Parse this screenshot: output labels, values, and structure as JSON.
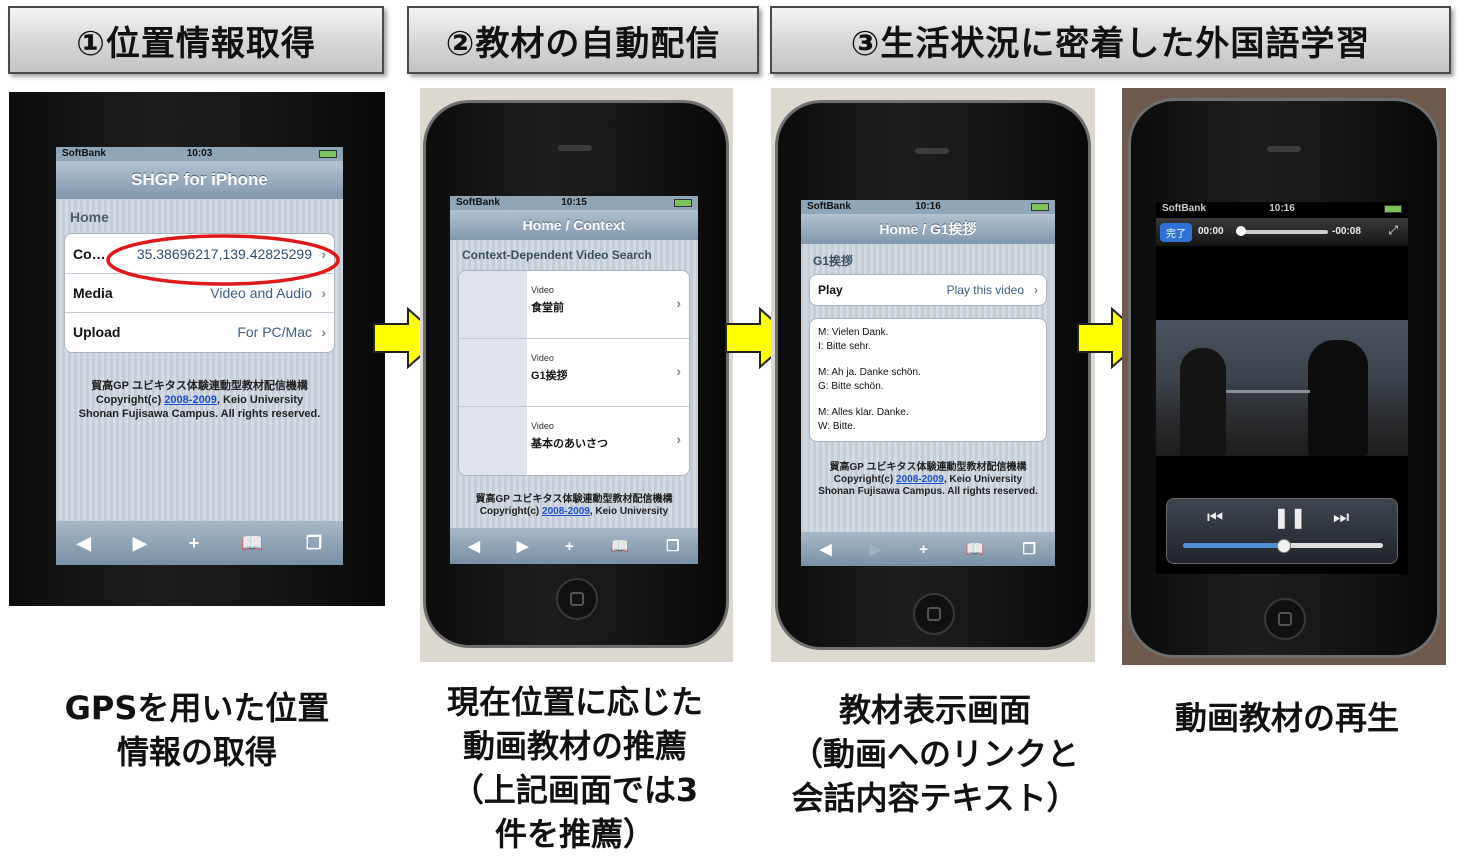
{
  "steps": [
    {
      "label": "①位置情報取得"
    },
    {
      "label": "②教材の自動配信"
    },
    {
      "label": "③生活状況に密着した外国語学習"
    }
  ],
  "captions": {
    "c1": [
      "GPSを用いた位置",
      "情報の取得"
    ],
    "c2": [
      "現在位置に応じた",
      "動画教材の推薦",
      "（上記画面では3",
      "件を推薦）"
    ],
    "c3": [
      "教材表示画面",
      "（動画へのリンクと",
      "会話内容テキスト）"
    ],
    "c4": [
      "動画教材の再生"
    ]
  },
  "phone1": {
    "carrier": "SoftBank",
    "time": "10:03",
    "title": "SHGP for iPhone",
    "section": "Home",
    "rows": [
      {
        "label": "Co…",
        "value": "35.38696217,139.42825299"
      },
      {
        "label": "Media",
        "value": "Video and Audio"
      },
      {
        "label": "Upload",
        "value": "For PC/Mac"
      }
    ],
    "footer_line1": "貿高GP ユビキタス体験連動型教材配信機構",
    "footer_copy": "Copyright(c)",
    "footer_years": "2008-2009",
    "footer_rest": ", Keio University",
    "footer_line3": "Shonan Fujisawa Campus. All rights reserved.",
    "highlight_color": "#e01818"
  },
  "phone2": {
    "carrier": "SoftBank",
    "time": "10:15",
    "title": "Home / Context",
    "section": "Context-Dependent Video Search",
    "items": [
      {
        "type": "Video",
        "name": "食堂前"
      },
      {
        "type": "Video",
        "name": "G1挨拶"
      },
      {
        "type": "Video",
        "name": "基本のあいさつ"
      }
    ],
    "footer_line1": "貿高GP ユビキタス体験連動型教材配信機構",
    "footer_copy": "Copyright(c)",
    "footer_years": "2008-2009",
    "footer_rest": ", Keio University"
  },
  "phone3": {
    "carrier": "SoftBank",
    "time": "10:16",
    "title": "Home / G1挨拶",
    "section": "G1挨拶",
    "play_label": "Play",
    "play_value": "Play this video",
    "dialogue": [
      "M: Vielen Dank.",
      "I: Bitte sehr.",
      "",
      "M: Ah ja. Danke schön.",
      "G: Bitte schön.",
      "",
      "M: Alles klar. Danke.",
      "W: Bitte."
    ],
    "footer_line1": "貿高GP ユビキタス体験連動型教材配信機構",
    "footer_copy": "Copyright(c)",
    "footer_years": "2008-2009",
    "footer_rest": ", Keio University",
    "footer_line3": "Shonan Fujisawa Campus. All rights reserved."
  },
  "phone4": {
    "carrier": "SoftBank",
    "time": "10:16",
    "done_label": "完了",
    "elapsed": "00:00",
    "remaining": "-00:08",
    "progress": 0.0,
    "volume": 0.5
  },
  "colors": {
    "arrow_fill": "#ffff00",
    "arrow_stroke": "#222222"
  }
}
